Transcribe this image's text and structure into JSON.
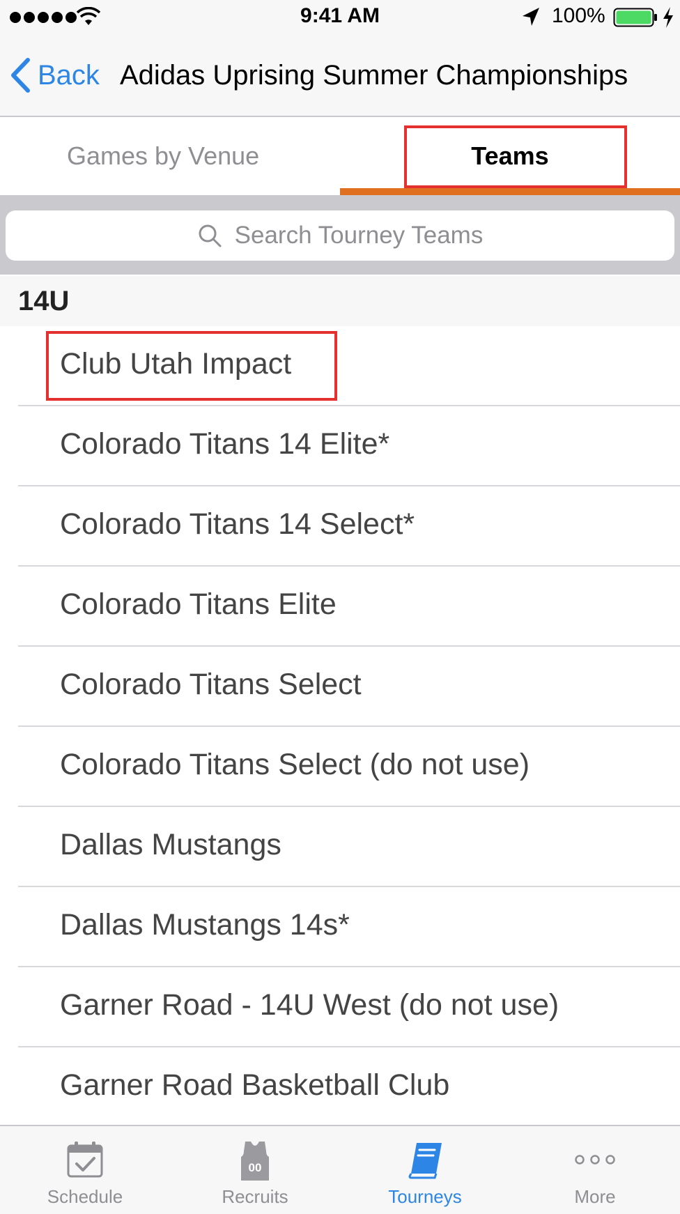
{
  "status_bar": {
    "time": "9:41 AM",
    "battery": "100%",
    "signal_icon": "signal-dots-icon",
    "wifi_icon": "wifi-icon",
    "location_icon": "location-arrow-icon",
    "battery_icon": "battery-icon",
    "charging_icon": "charging-bolt-icon",
    "battery_color": "#4cd964"
  },
  "nav": {
    "back_label": "Back",
    "back_icon": "chevron-left-icon",
    "title": "Adidas Uprising Summer Championships"
  },
  "tabs": {
    "venue_label": "Games by Venue",
    "teams_label": "Teams",
    "active": "Teams",
    "accent_color": "#e07020"
  },
  "search": {
    "placeholder": "Search Tourney Teams",
    "icon": "search-icon"
  },
  "section": {
    "title": "14U"
  },
  "teams": [
    "Club Utah Impact",
    "Colorado Titans 14 Elite*",
    "Colorado Titans 14 Select*",
    "Colorado Titans Elite",
    "Colorado Titans Select",
    "Colorado Titans Select (do not use)",
    "Dallas Mustangs",
    "Dallas Mustangs 14s*",
    "Garner Road - 14U West (do not use)",
    "Garner Road Basketball Club"
  ],
  "tab_bar": {
    "items": [
      {
        "label": "Schedule",
        "icon": "calendar-check-icon"
      },
      {
        "label": "Recruits",
        "icon": "jersey-icon",
        "jersey_number": "00"
      },
      {
        "label": "Tourneys",
        "icon": "book-icon"
      },
      {
        "label": "More",
        "icon": "more-dots-icon"
      }
    ],
    "active": "Tourneys",
    "active_color": "#2d86e6",
    "inactive_color": "#8e8e93"
  },
  "highlight_color": "#e53030"
}
